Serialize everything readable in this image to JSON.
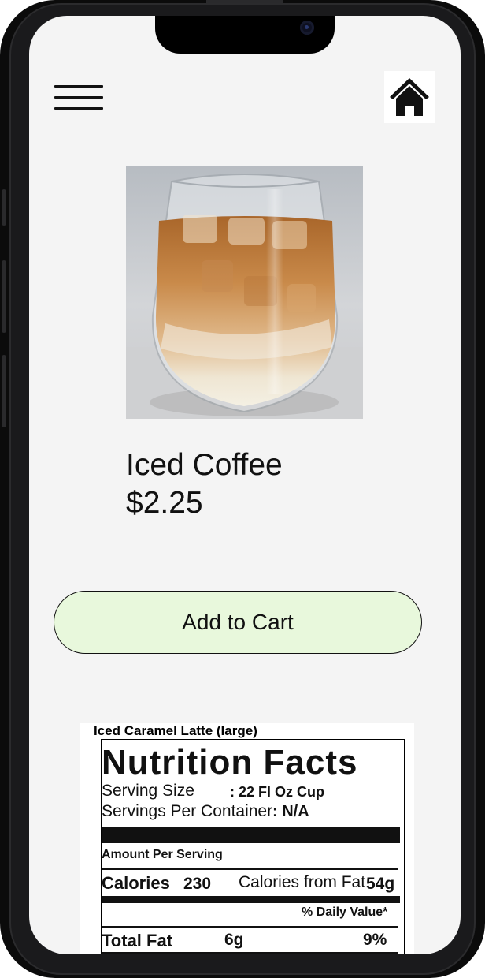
{
  "header": {
    "menu_icon": "hamburger-menu-icon",
    "home_icon": "home-icon"
  },
  "product": {
    "image_icon": "iced-coffee-photo",
    "name": "Iced Coffee",
    "price": "$2.25"
  },
  "actions": {
    "add_to_cart_label": "Add to Cart",
    "add_to_cart_color": "#e8f8dc"
  },
  "nutrition": {
    "caption": "Iced Caramel Latte (large)",
    "title": "Nutrition Facts",
    "serving_size_label": "Serving Size",
    "serving_size_value": ": 22 Fl Oz Cup",
    "servings_per_container_label": "Servings Per Container",
    "servings_per_container_value": ": N/A",
    "amount_per_serving": "Amount Per Serving",
    "calories_label": "Calories",
    "calories_value": "230",
    "calories_from_fat_label": "Calories from Fat",
    "calories_from_fat_value": "54g",
    "daily_value_header": "% Daily Value*",
    "total_fat_label": "Total Fat",
    "total_fat_amount": "6g",
    "total_fat_percent": "9%"
  }
}
